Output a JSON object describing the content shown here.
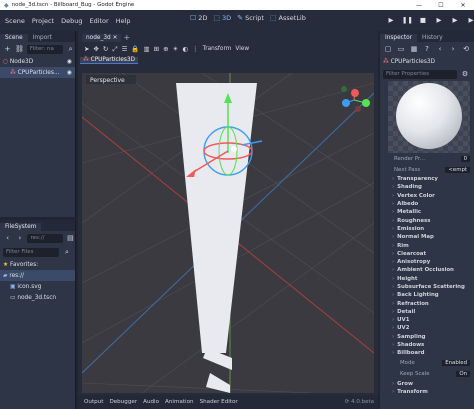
{
  "window": {
    "title": "node_3d.tscn - Billboard_Bug - Godot Engine",
    "minimize": "—",
    "maximize": "☐",
    "close": "✕"
  },
  "menu": {
    "items": [
      "Scene",
      "Project",
      "Debug",
      "Editor",
      "Help"
    ]
  },
  "workspaces": [
    {
      "label": "2D",
      "icon": "☐"
    },
    {
      "label": "3D",
      "icon": "⬚"
    },
    {
      "label": "Script",
      "icon": "✎"
    },
    {
      "label": "AssetLib",
      "icon": "⬚"
    }
  ],
  "play": {
    "play": "▶",
    "pause": "❚❚",
    "stop": "■",
    "remote": "▶",
    "scene": "▶",
    "custom": "▶"
  },
  "scene_dock": {
    "tabs": [
      "Scene",
      "Import"
    ],
    "filter_placeholder": "Filter: na",
    "tree": [
      {
        "label": "Node3D"
      },
      {
        "label": "CPUParticles..."
      }
    ]
  },
  "filesystem_dock": {
    "title": "FileSystem",
    "path": "res://",
    "filter_placeholder": "Filter Files",
    "favorites_label": "Favorites:",
    "items": [
      "res://",
      "icon.svg",
      "node_3d.tscn"
    ]
  },
  "editor": {
    "scene_tab": "node_3d",
    "transform_label": "Transform",
    "view_label": "View",
    "selected_node": "CPUParticles3D",
    "viewport_label": "Perspective",
    "bottom": [
      "Output",
      "Debugger",
      "Audio",
      "Animation",
      "Shader Editor"
    ],
    "version": "4.0.beta"
  },
  "inspector": {
    "tabs": [
      "Inspector",
      "History"
    ],
    "node": "CPUParticles3D",
    "filter_placeholder": "Filter Properties",
    "render_priority_label": "Render Pr...",
    "render_priority_value": "0",
    "next_pass_label": "Next Pass",
    "next_pass_value": "<empt",
    "sections": [
      "Transparency",
      "Shading",
      "Vertex Color",
      "Albedo",
      "Metallic",
      "Roughness",
      "Emission",
      "Normal Map",
      "Rim",
      "Clearcoat",
      "Anisotropy",
      "Ambient Occlusion",
      "Height",
      "Subsurface Scattering",
      "Back Lighting",
      "Refraction",
      "Detail",
      "UV1",
      "UV2",
      "Sampling",
      "Shadows",
      "Billboard"
    ],
    "billboard_mode_label": "Mode",
    "billboard_mode_value": "Enabled",
    "keep_scale_label": "Keep Scale",
    "keep_scale_value": "On",
    "after": [
      "Grow",
      "Transform"
    ]
  },
  "colors": {
    "accent": "#478cbf",
    "selection": "#3a4a68",
    "red_axis": "#f05a5a",
    "green_axis": "#56e34f",
    "blue_axis": "#3d9cf5"
  }
}
